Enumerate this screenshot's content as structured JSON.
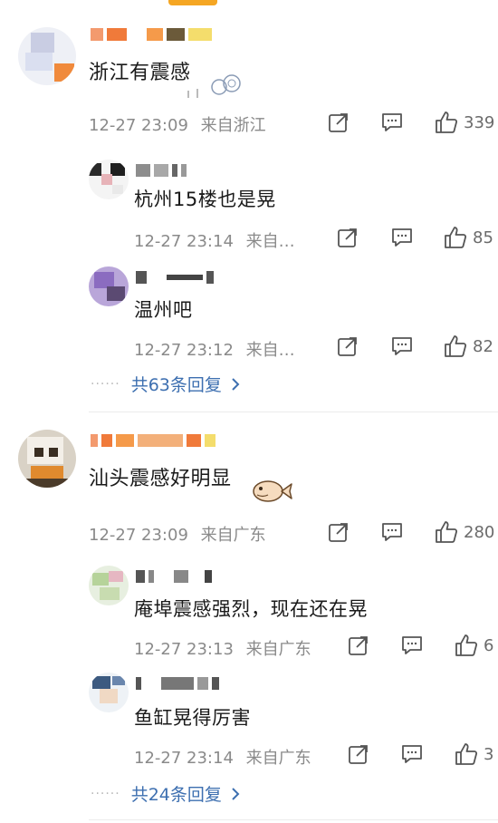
{
  "colors": {
    "accent": "#f5a623",
    "link": "#3d6fb0",
    "meta": "#8a8a8a"
  },
  "comments": [
    {
      "text": "浙江有震感",
      "time": "12-27 23:09",
      "location": "来自浙江",
      "likes": "339",
      "replies": [
        {
          "text": "杭州15楼也是晃",
          "time": "12-27 23:14",
          "location": "来自…",
          "likes": "85"
        },
        {
          "text": "温州吧",
          "time": "12-27 23:12",
          "location": "来自…",
          "likes": "82"
        }
      ],
      "more_replies": "共63条回复"
    },
    {
      "text": "汕头震感好明显",
      "time": "12-27 23:09",
      "location": "来自广东",
      "likes": "280",
      "replies": [
        {
          "text": "庵埠震感强烈，现在还在晃",
          "time": "12-27 23:13",
          "location": "来自广东",
          "likes": "6"
        },
        {
          "text": "鱼缸晃得厉害",
          "time": "12-27 23:14",
          "location": "来自广东",
          "likes": "3"
        }
      ],
      "more_replies": "共24条回复"
    }
  ],
  "icons": {
    "share": "share-icon",
    "comment": "comment-icon",
    "like": "thumbs-up-icon",
    "chevron": "chevron-right-icon"
  }
}
